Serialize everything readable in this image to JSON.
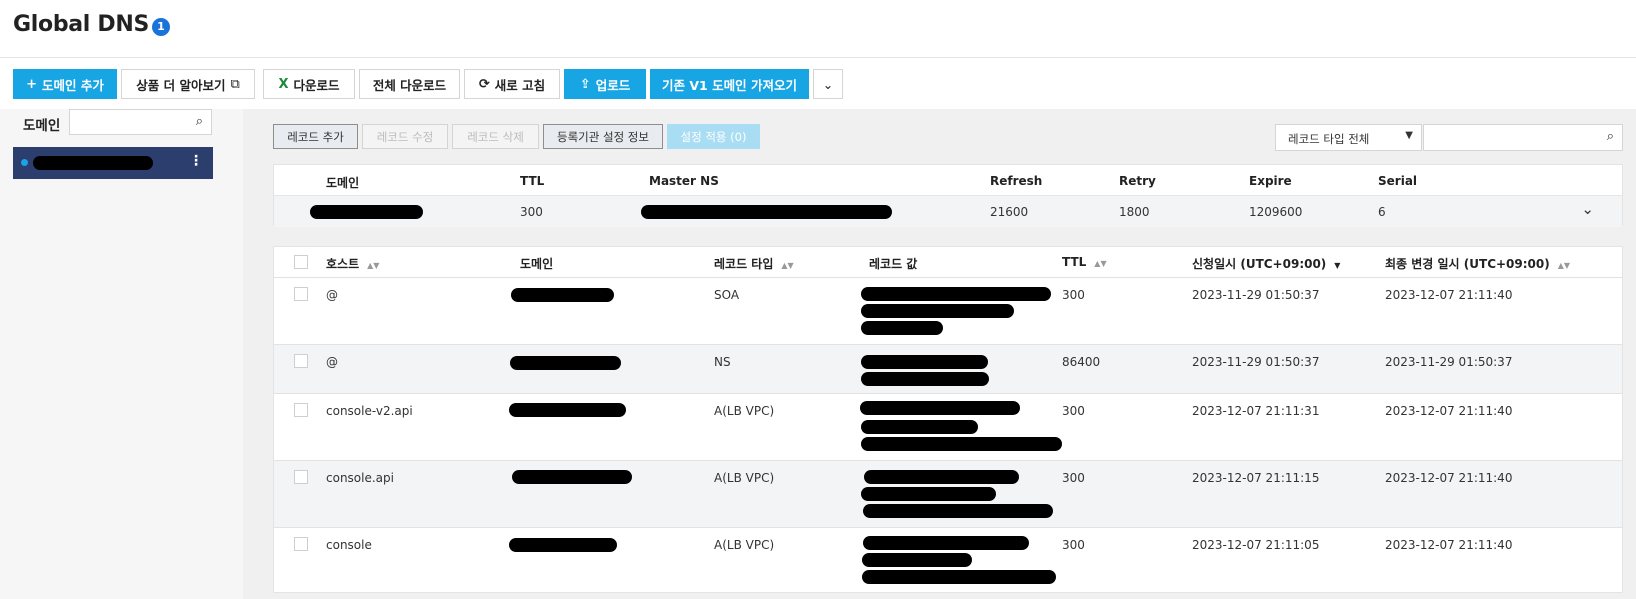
{
  "page": {
    "title": "Global DNS",
    "badge": "1"
  },
  "toolbar": {
    "add_domain": "도메인 추가",
    "learn_more": "상품 더 알아보기",
    "download": "다운로드",
    "download_all": "전체 다운로드",
    "refresh": "새로 고침",
    "upload": "업로드",
    "import_v1": "기존 V1 도메인 가져오기"
  },
  "icons": {
    "plus": "plus-icon",
    "external": "external-link-icon",
    "excel": "excel-icon",
    "refresh": "refresh-icon",
    "upload": "upload-icon",
    "chevron": "chevron-down-icon",
    "search": "search-icon",
    "more": "more-vertical-icon"
  },
  "colors": {
    "primary": "#17a5e3",
    "sidebar_selected": "#2c3e6e",
    "badge": "#1a73d9"
  },
  "sidebar": {
    "label": "도메인",
    "search_placeholder": "",
    "items": [
      {
        "label": ""
      }
    ]
  },
  "actions": {
    "add_record": "레코드 추가",
    "edit_record": "레코드 수정",
    "delete_record": "레코드 삭제",
    "registrar_info": "등록기관 설정 정보",
    "apply_settings": "설정 적용 (0)"
  },
  "filter": {
    "record_type": "레코드 타입 전체",
    "search_value": ""
  },
  "zone": {
    "headers": {
      "domain": "도메인",
      "ttl": "TTL",
      "master_ns": "Master NS",
      "refresh": "Refresh",
      "retry": "Retry",
      "expire": "Expire",
      "serial": "Serial"
    },
    "row": {
      "ttl": "300",
      "refresh": "21600",
      "retry": "1800",
      "expire": "1209600",
      "serial": "6"
    }
  },
  "records": {
    "headers": {
      "host": "호스트",
      "domain": "도메인",
      "type": "레코드 타입",
      "value": "레코드 값",
      "ttl": "TTL",
      "requested": "신청일시 (UTC+09:00)",
      "modified": "최종 변경 일시 (UTC+09:00)"
    },
    "rows": [
      {
        "host": "@",
        "type": "SOA",
        "ttl": "300",
        "requested": "2023-11-29 01:50:37",
        "modified": "2023-12-07 21:11:40"
      },
      {
        "host": "@",
        "type": "NS",
        "ttl": "86400",
        "requested": "2023-11-29 01:50:37",
        "modified": "2023-11-29 01:50:37"
      },
      {
        "host": "console-v2.api",
        "type": "A(LB VPC)",
        "ttl": "300",
        "requested": "2023-12-07 21:11:31",
        "modified": "2023-12-07 21:11:40"
      },
      {
        "host": "console.api",
        "type": "A(LB VPC)",
        "ttl": "300",
        "requested": "2023-12-07 21:11:15",
        "modified": "2023-12-07 21:11:40"
      },
      {
        "host": "console",
        "type": "A(LB VPC)",
        "ttl": "300",
        "requested": "2023-12-07 21:11:05",
        "modified": "2023-12-07 21:11:40"
      }
    ]
  }
}
